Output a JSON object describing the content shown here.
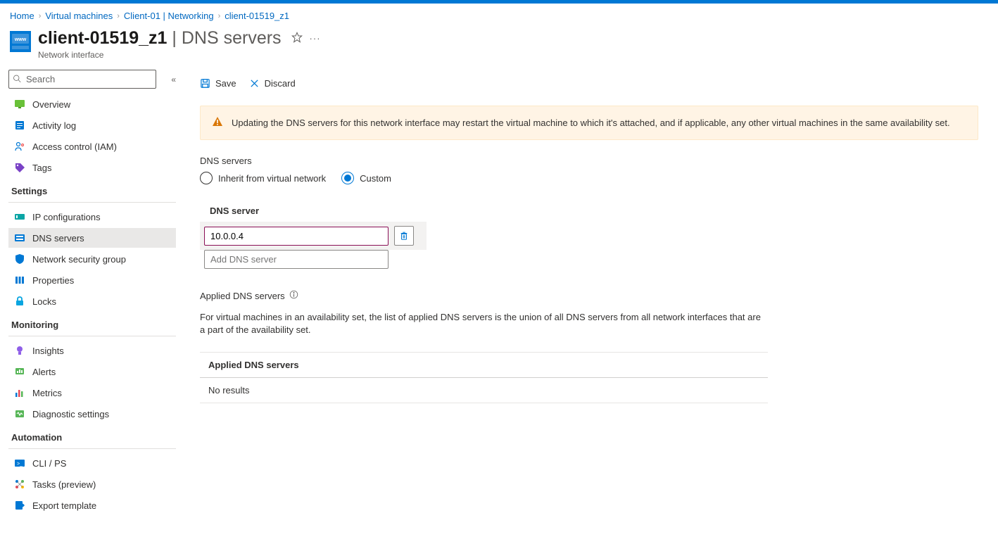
{
  "breadcrumb": [
    {
      "label": "Home"
    },
    {
      "label": "Virtual machines"
    },
    {
      "label": "Client-01 | Networking"
    },
    {
      "label": "client-01519_z1"
    }
  ],
  "header": {
    "title_main": "client-01519_z1",
    "title_light": "DNS servers",
    "subtitle": "Network interface"
  },
  "sidebar": {
    "search_placeholder": "Search",
    "items_top": [
      {
        "key": "overview",
        "label": "Overview"
      },
      {
        "key": "activity-log",
        "label": "Activity log"
      },
      {
        "key": "access-control",
        "label": "Access control (IAM)"
      },
      {
        "key": "tags",
        "label": "Tags"
      }
    ],
    "section_settings": "Settings",
    "items_settings": [
      {
        "key": "ip-configurations",
        "label": "IP configurations"
      },
      {
        "key": "dns-servers",
        "label": "DNS servers",
        "selected": true
      },
      {
        "key": "nsg",
        "label": "Network security group"
      },
      {
        "key": "properties",
        "label": "Properties"
      },
      {
        "key": "locks",
        "label": "Locks"
      }
    ],
    "section_monitoring": "Monitoring",
    "items_monitoring": [
      {
        "key": "insights",
        "label": "Insights"
      },
      {
        "key": "alerts",
        "label": "Alerts"
      },
      {
        "key": "metrics",
        "label": "Metrics"
      },
      {
        "key": "diagnostic",
        "label": "Diagnostic settings"
      }
    ],
    "section_automation": "Automation",
    "items_automation": [
      {
        "key": "cli-ps",
        "label": "CLI / PS"
      },
      {
        "key": "tasks",
        "label": "Tasks (preview)"
      },
      {
        "key": "export-template",
        "label": "Export template"
      }
    ]
  },
  "toolbar": {
    "save_label": "Save",
    "discard_label": "Discard"
  },
  "warning_text": "Updating the DNS servers for this network interface may restart the virtual machine to which it's attached, and if applicable, any other virtual machines in the same availability set.",
  "dns": {
    "group_label": "DNS servers",
    "option_inherit": "Inherit from virtual network",
    "option_custom": "Custom",
    "table_header": "DNS server",
    "entries": [
      "10.0.0.4"
    ],
    "add_placeholder": "Add DNS server"
  },
  "applied": {
    "label": "Applied DNS servers",
    "description": "For virtual machines in an availability set, the list of applied DNS servers is the union of all DNS servers from all network interfaces that are a part of the availability set.",
    "table_header": "Applied DNS servers",
    "no_results": "No results"
  }
}
